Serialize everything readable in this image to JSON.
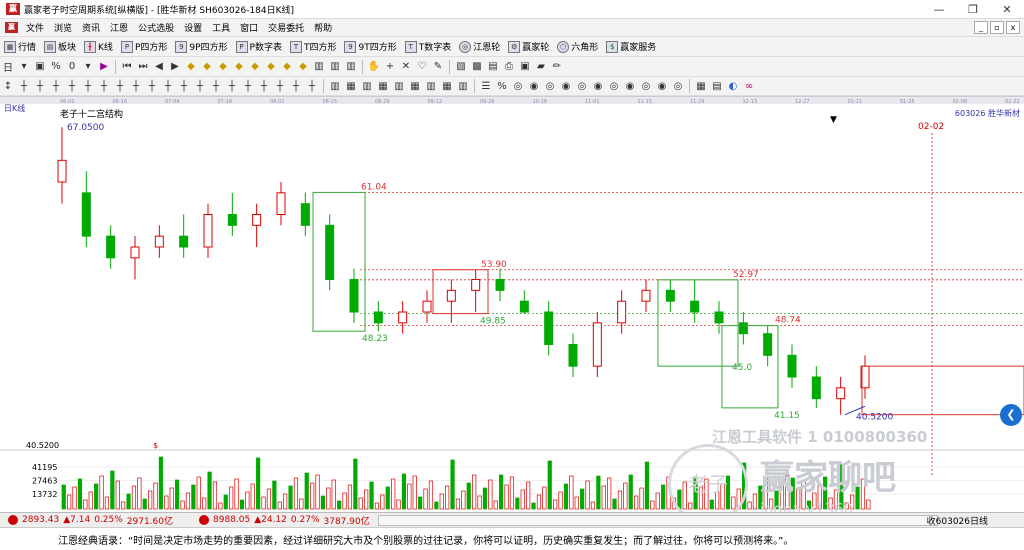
{
  "window": {
    "title": "赢家老子时空周期系统[纵横版] - [胜华新材  SH603026-184日K线]",
    "app_icon": "赢"
  },
  "menu": [
    "文件",
    "浏览",
    "资讯",
    "江恩",
    "公式选股",
    "设置",
    "工具",
    "窗口",
    "交易委托",
    "帮助"
  ],
  "toolbar1": [
    {
      "label": "行情",
      "icon": "grid-icon"
    },
    {
      "label": "板块",
      "icon": "blocks-icon"
    },
    {
      "label": "K线",
      "icon": "kline-icon"
    },
    {
      "label": "P四方形",
      "icon": "p-square-icon"
    },
    {
      "label": "9P四方形",
      "icon": "9p-square-icon"
    },
    {
      "label": "P数字表",
      "icon": "p-table-icon"
    },
    {
      "label": "T四方形",
      "icon": "t-square-icon"
    },
    {
      "label": "9T四方形",
      "icon": "9t-square-icon"
    },
    {
      "label": "T数字表",
      "icon": "t-table-icon"
    },
    {
      "label": "江恩轮",
      "icon": "gann-wheel-icon"
    },
    {
      "label": "赢家轮",
      "icon": "winner-wheel-icon"
    },
    {
      "label": "六角形",
      "icon": "hexagon-icon"
    },
    {
      "label": "赢家服务",
      "icon": "service-icon"
    }
  ],
  "toolbar2_zero": "0",
  "chart": {
    "period_label": "日K线",
    "indicator_label": "老子十二宫结构",
    "stock_info": "603026 胜华新材",
    "date_ticks": [
      "06-02",
      "06-16",
      "07-04",
      "07-18",
      "08-01",
      "08-15",
      "08-29",
      "09-12",
      "09-26",
      "10-18",
      "11-01",
      "11-15",
      "11-29",
      "12-13",
      "12-27",
      "01-11",
      "01-25",
      "02-08",
      "02-22"
    ],
    "future_date_label": "02-02",
    "box_labels": [
      "61.04",
      "53.90",
      "49.85",
      "52.97",
      "48.74",
      "48.23",
      "41.15",
      "40.5200"
    ],
    "price_high_label": "67.0500",
    "box_label_near_45": "45.0",
    "left_axis": {
      "top_label": "40.5200",
      "volume_labels": [
        "41195",
        "27463",
        "13732"
      ]
    },
    "volume_marker": "$",
    "bottom_right_label": "收603026日线"
  },
  "status": {
    "shanghai": {
      "value": "2893.43",
      "change": "7.14",
      "pct": "0.25%",
      "amount": "2971.60亿"
    },
    "shenzhen": {
      "value": "8988.05",
      "change": "24.12",
      "pct": "0.27%",
      "amount": "3787.90亿"
    }
  },
  "quote": "江恩经典语录：“时间是决定市场走势的重要因素，经过详细研究大市及个别股票的过往记录，你将可以证明，历史确实重复发生；而了解过往，你将可以预测将来。”。",
  "watermark": {
    "line1": "江恩工具软件 1 0100800360",
    "line2": "赢家聊吧",
    "line3": "iaoba.v1360",
    "logo": "老子"
  },
  "chart_data": {
    "type": "candlestick",
    "title": "",
    "period": "日K线",
    "x_dates": [
      "06-02",
      "06-16",
      "07-04",
      "07-18",
      "08-01",
      "08-15",
      "08-29",
      "09-12",
      "09-26",
      "10-18",
      "11-01",
      "11-15",
      "11-29",
      "12-13",
      "12-27",
      "01-11"
    ],
    "ohlc_approx": [
      [
        62,
        67.05,
        60,
        64
      ],
      [
        61,
        63,
        56,
        57
      ],
      [
        57,
        58,
        54,
        55
      ],
      [
        55,
        57,
        53,
        56
      ],
      [
        56,
        58,
        55,
        57
      ],
      [
        57,
        59,
        55,
        56
      ],
      [
        56,
        60,
        55,
        59
      ],
      [
        59,
        61,
        57,
        58
      ],
      [
        58,
        60,
        56,
        59
      ],
      [
        59,
        62,
        58,
        61
      ],
      [
        60,
        61.04,
        57,
        58
      ],
      [
        58,
        59,
        52,
        53
      ],
      [
        53,
        54,
        49,
        50
      ],
      [
        50,
        51,
        48.23,
        49
      ],
      [
        49,
        51,
        48,
        50
      ],
      [
        50,
        52,
        49,
        51
      ],
      [
        51,
        53,
        49,
        52
      ],
      [
        52,
        53.9,
        50,
        53
      ],
      [
        53,
        54,
        51,
        52
      ],
      [
        51,
        52,
        49.85,
        50
      ],
      [
        50,
        51,
        46,
        47
      ],
      [
        47,
        48,
        44,
        45
      ],
      [
        45,
        50,
        44,
        49
      ],
      [
        49,
        52,
        48,
        51
      ],
      [
        51,
        53,
        50,
        52
      ],
      [
        52,
        53,
        50,
        51
      ],
      [
        51,
        52.97,
        49,
        50
      ],
      [
        50,
        51,
        48,
        49
      ],
      [
        49,
        50,
        47,
        48
      ],
      [
        48,
        48.74,
        45,
        46
      ],
      [
        46,
        47,
        43,
        44
      ],
      [
        44,
        45,
        41.15,
        42
      ],
      [
        42,
        44,
        40.52,
        43
      ],
      [
        43,
        46,
        42,
        45
      ]
    ],
    "ylim": [
      40.52,
      67.05
    ],
    "levels": [
      61.04,
      53.9,
      52.97,
      49.85,
      48.74,
      48.23,
      41.15,
      40.52
    ]
  }
}
